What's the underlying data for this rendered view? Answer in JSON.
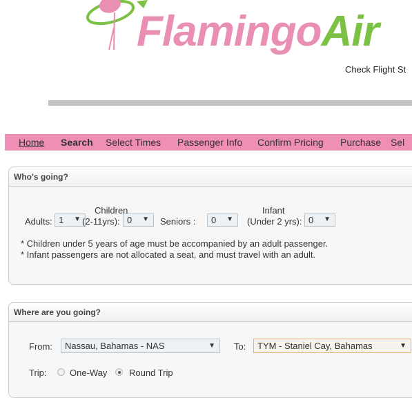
{
  "brand": {
    "name_part1": "Flamingo",
    "name_part2": "Air",
    "pink": "#ea8fb4",
    "green": "#7cc143"
  },
  "header": {
    "check_flight_link": "Check Flight St"
  },
  "nav": {
    "color": "#ef8fb5",
    "items": [
      {
        "label": "Home"
      },
      {
        "label": "Search"
      },
      {
        "label": "Select Times"
      },
      {
        "label": "Passenger Info"
      },
      {
        "label": "Confirm Pricing"
      },
      {
        "label": "Purchase"
      },
      {
        "label": "Sel"
      }
    ]
  },
  "whos_going": {
    "title": "Who's going?",
    "adults_label": "Adults:",
    "adults_value": "1",
    "children_label1": "Children",
    "children_label2": "(2-11yrs):",
    "children_value": "0",
    "seniors_label": "Seniors :",
    "seniors_value": "0",
    "infant_label1": "Infant",
    "infant_label2": "(Under 2 yrs):",
    "infant_value": "0",
    "notes": [
      "* Children under 5 years of age must be accompanied by an adult passenger.",
      "* Infant passengers are not allocated a seat, and must travel with an adult."
    ]
  },
  "where_going": {
    "title": "Where are you going?",
    "from_label": "From:",
    "from_value": "Nassau, Bahamas - NAS",
    "to_label": "To:",
    "to_value": "TYM - Staniel Cay, Bahamas",
    "trip_label": "Trip:",
    "trip_options": [
      {
        "label": "One-Way",
        "selected": false
      },
      {
        "label": "Round Trip",
        "selected": true
      }
    ]
  }
}
